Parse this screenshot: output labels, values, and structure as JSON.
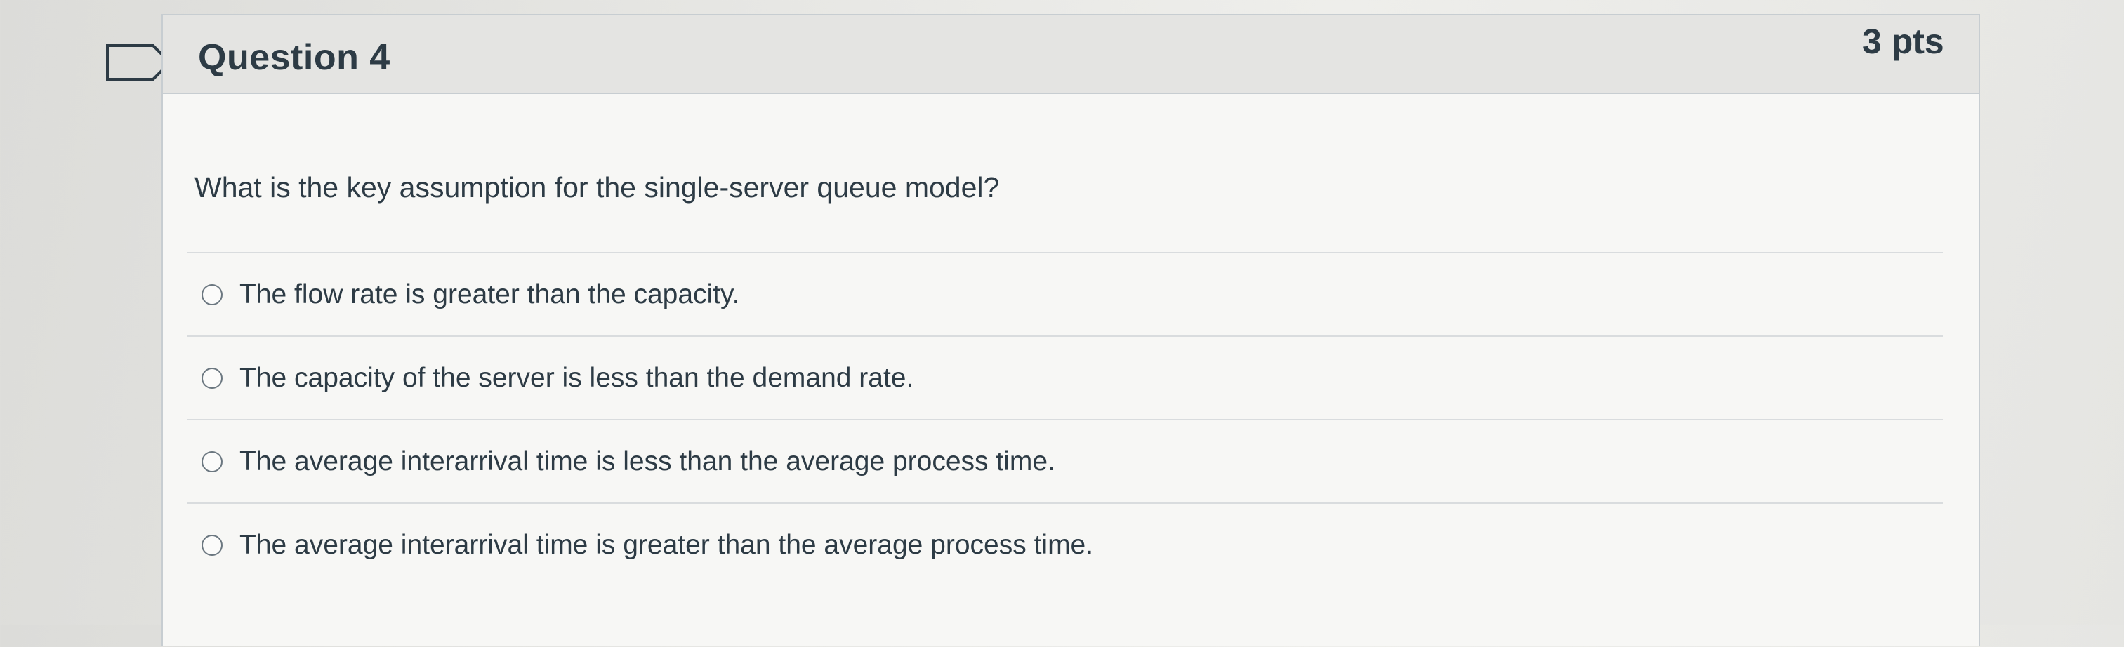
{
  "question": {
    "title": "Question 4",
    "points": "3 pts",
    "text": "What is the key assumption for the single-server queue model?",
    "answers": [
      {
        "label": "The flow rate is greater than the capacity.",
        "selected": false
      },
      {
        "label": "The capacity of the server is less than the demand rate.",
        "selected": false
      },
      {
        "label": "The average interarrival time is less than the average process time.",
        "selected": false
      },
      {
        "label": "The average interarrival time is greater than the average process time.",
        "selected": false
      }
    ]
  },
  "colors": {
    "text": "#2d3b45",
    "header_bg": "#e4e4e2",
    "border": "#c7cdd1"
  },
  "icons": {
    "flag": "bookmark-flag-icon",
    "radio": "radio-button-icon"
  }
}
